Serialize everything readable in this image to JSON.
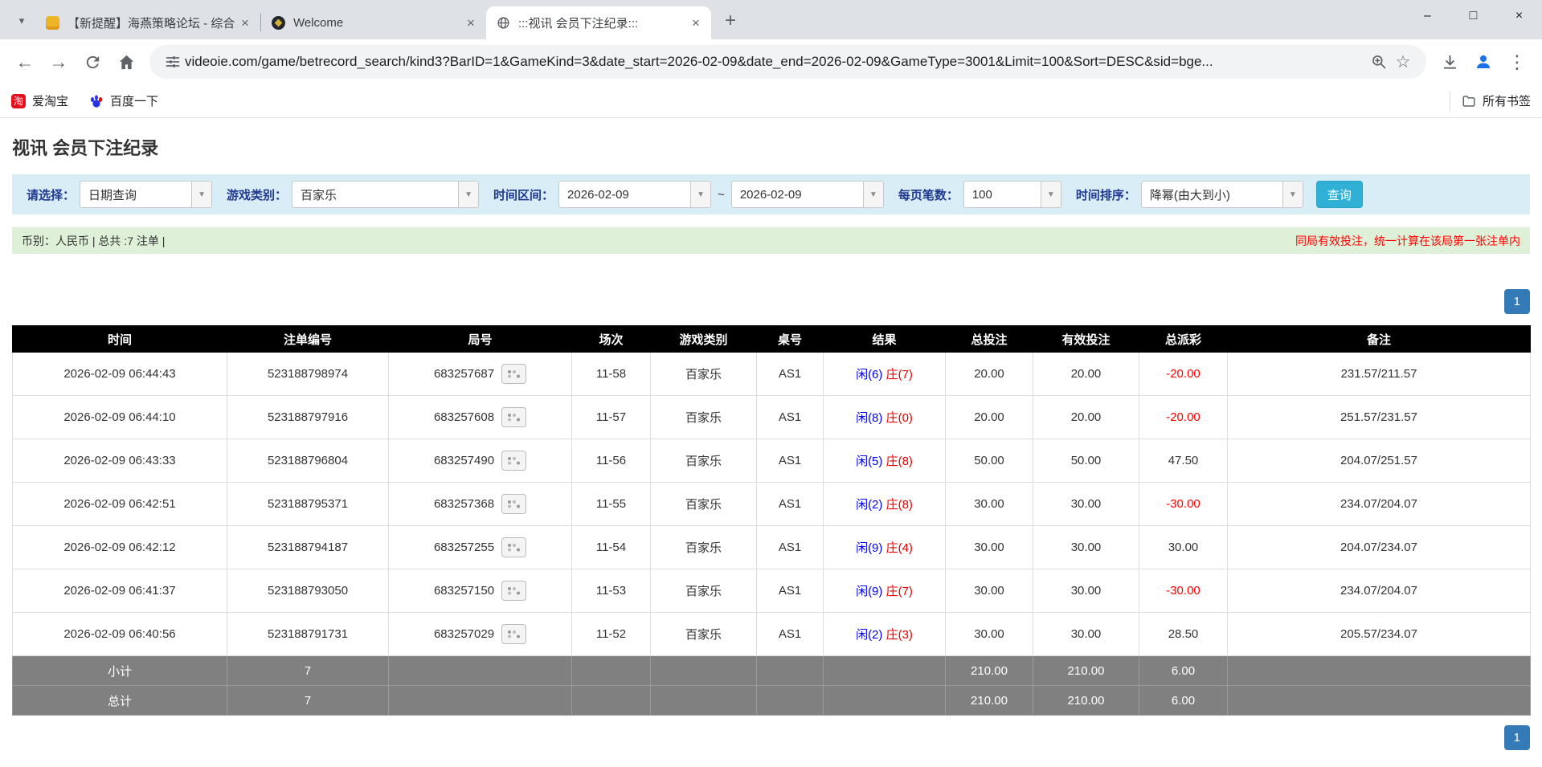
{
  "icons": {
    "tab_search": "▾",
    "close": "×",
    "new_tab": "+",
    "minimize": "–",
    "maximize": "□",
    "window_close": "×",
    "back": "←",
    "forward": "→",
    "star": "☆",
    "menu": "⋮",
    "dropdown": "▼",
    "taobao": "淘"
  },
  "browser": {
    "tabs": [
      {
        "title": "【新提醒】海燕策略论坛 - 综合",
        "active": false
      },
      {
        "title": "Welcome",
        "active": false
      },
      {
        "title": ":::视讯 会员下注纪录:::",
        "active": true
      }
    ],
    "url": "videoie.com/game/betrecord_search/kind3?BarID=1&GameKind=3&date_start=2026-02-09&date_end=2026-02-09&GameType=3001&Limit=100&Sort=DESC&sid=bge...",
    "bookmarks": [
      {
        "label": "爱淘宝"
      },
      {
        "label": "百度一下"
      }
    ],
    "all_bookmarks_label": "所有书签"
  },
  "page": {
    "title": "视讯 会员下注纪录",
    "filters": {
      "select_label": "请选择：",
      "select_value": "日期查询",
      "game_type_label": "游戏类别：",
      "game_type_value": "百家乐",
      "date_range_label": "时间区间：",
      "date_start": "2026-02-09",
      "date_separator": "~",
      "date_end": "2026-02-09",
      "per_page_label": "每页笔数：",
      "per_page_value": "100",
      "sort_label": "时间排序：",
      "sort_value": "降幂(由大到小)",
      "search_button": "查询"
    },
    "info_bar": {
      "left": "币别：人民币 | 总共 :7 注单 |",
      "right": "同局有效投注，统一计算在该局第一张注单内"
    },
    "pagination": {
      "page": "1"
    },
    "table": {
      "headers": [
        "时间",
        "注单编号",
        "局号",
        "场次",
        "游戏类别",
        "桌号",
        "结果",
        "总投注",
        "有效投注",
        "总派彩",
        "备注"
      ],
      "rows": [
        {
          "time": "2026-02-09 06:44:43",
          "bet_id": "523188798974",
          "round_id": "683257687",
          "session": "11-58",
          "game": "百家乐",
          "table_no": "AS1",
          "result_player": "闲(6)",
          "result_banker": "庄(7)",
          "total_bet": "20.00",
          "valid_bet": "20.00",
          "payout": "-20.00",
          "note": "231.57/211.57"
        },
        {
          "time": "2026-02-09 06:44:10",
          "bet_id": "523188797916",
          "round_id": "683257608",
          "session": "11-57",
          "game": "百家乐",
          "table_no": "AS1",
          "result_player": "闲(8)",
          "result_banker": "庄(0)",
          "total_bet": "20.00",
          "valid_bet": "20.00",
          "payout": "-20.00",
          "note": "251.57/231.57"
        },
        {
          "time": "2026-02-09 06:43:33",
          "bet_id": "523188796804",
          "round_id": "683257490",
          "session": "11-56",
          "game": "百家乐",
          "table_no": "AS1",
          "result_player": "闲(5)",
          "result_banker": "庄(8)",
          "total_bet": "50.00",
          "valid_bet": "50.00",
          "payout": "47.50",
          "note": "204.07/251.57"
        },
        {
          "time": "2026-02-09 06:42:51",
          "bet_id": "523188795371",
          "round_id": "683257368",
          "session": "11-55",
          "game": "百家乐",
          "table_no": "AS1",
          "result_player": "闲(2)",
          "result_banker": "庄(8)",
          "total_bet": "30.00",
          "valid_bet": "30.00",
          "payout": "-30.00",
          "note": "234.07/204.07"
        },
        {
          "time": "2026-02-09 06:42:12",
          "bet_id": "523188794187",
          "round_id": "683257255",
          "session": "11-54",
          "game": "百家乐",
          "table_no": "AS1",
          "result_player": "闲(9)",
          "result_banker": "庄(4)",
          "total_bet": "30.00",
          "valid_bet": "30.00",
          "payout": "30.00",
          "note": "204.07/234.07"
        },
        {
          "time": "2026-02-09 06:41:37",
          "bet_id": "523188793050",
          "round_id": "683257150",
          "session": "11-53",
          "game": "百家乐",
          "table_no": "AS1",
          "result_player": "闲(9)",
          "result_banker": "庄(7)",
          "total_bet": "30.00",
          "valid_bet": "30.00",
          "payout": "-30.00",
          "note": "234.07/204.07"
        },
        {
          "time": "2026-02-09 06:40:56",
          "bet_id": "523188791731",
          "round_id": "683257029",
          "session": "11-52",
          "game": "百家乐",
          "table_no": "AS1",
          "result_player": "闲(2)",
          "result_banker": "庄(3)",
          "total_bet": "30.00",
          "valid_bet": "30.00",
          "payout": "28.50",
          "note": "205.57/234.07"
        }
      ],
      "subtotal": {
        "label": "小计",
        "count": "7",
        "total_bet": "210.00",
        "valid_bet": "210.00",
        "payout": "6.00"
      },
      "total": {
        "label": "总计",
        "count": "7",
        "total_bet": "210.00",
        "valid_bet": "210.00",
        "payout": "6.00"
      }
    }
  }
}
